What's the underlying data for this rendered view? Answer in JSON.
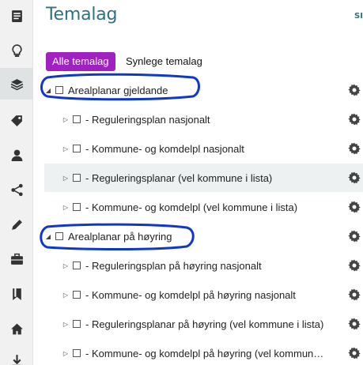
{
  "header": {
    "title": "Temalag",
    "edge_link": "SI"
  },
  "tabs": [
    {
      "label": "Alle temalag",
      "active": true
    },
    {
      "label": "Synlege temalag",
      "active": false
    }
  ],
  "sidebar": {
    "items": [
      {
        "icon": "document-icon"
      },
      {
        "icon": "lightbulb-icon"
      },
      {
        "icon": "layers-icon",
        "active": true
      },
      {
        "icon": "tag-icon"
      },
      {
        "icon": "user-icon"
      },
      {
        "icon": "share-icon"
      },
      {
        "icon": "pencil-icon"
      },
      {
        "icon": "briefcase-icon"
      },
      {
        "icon": "bookmark-icon"
      },
      {
        "icon": "home-icon"
      },
      {
        "icon": "download-icon"
      }
    ]
  },
  "layers": [
    {
      "label": "Arealplanar gjeldande",
      "kind": "group",
      "expanded": true,
      "circled": true
    },
    {
      "label": "- Reguleringsplan nasjonalt",
      "kind": "child"
    },
    {
      "label": "- Kommune- og komdelpl nasjonalt",
      "kind": "child"
    },
    {
      "label": "- Reguleringsplanar (vel kommune i lista)",
      "kind": "child",
      "highlight": true
    },
    {
      "label": "- Kommune- og komdelpl (vel kommune i lista)",
      "kind": "child"
    },
    {
      "label": "Arealplanar på høyring",
      "kind": "group",
      "expanded": true,
      "circled": true
    },
    {
      "label": "- Reguleringsplan på høyring nasjonalt",
      "kind": "child"
    },
    {
      "label": "- Kommune- og komdelpl på høyring nasjonalt",
      "kind": "child"
    },
    {
      "label": "- Reguleringsplanar på høyring (vel kommune i lista)",
      "kind": "child"
    },
    {
      "label": "- Kommune- og komdelpl på høyring (vel kommun…",
      "kind": "child"
    }
  ],
  "colors": {
    "accent": "#a020c0",
    "title": "#2f7181",
    "annotation": "#1038c8",
    "gear": "#444444"
  }
}
